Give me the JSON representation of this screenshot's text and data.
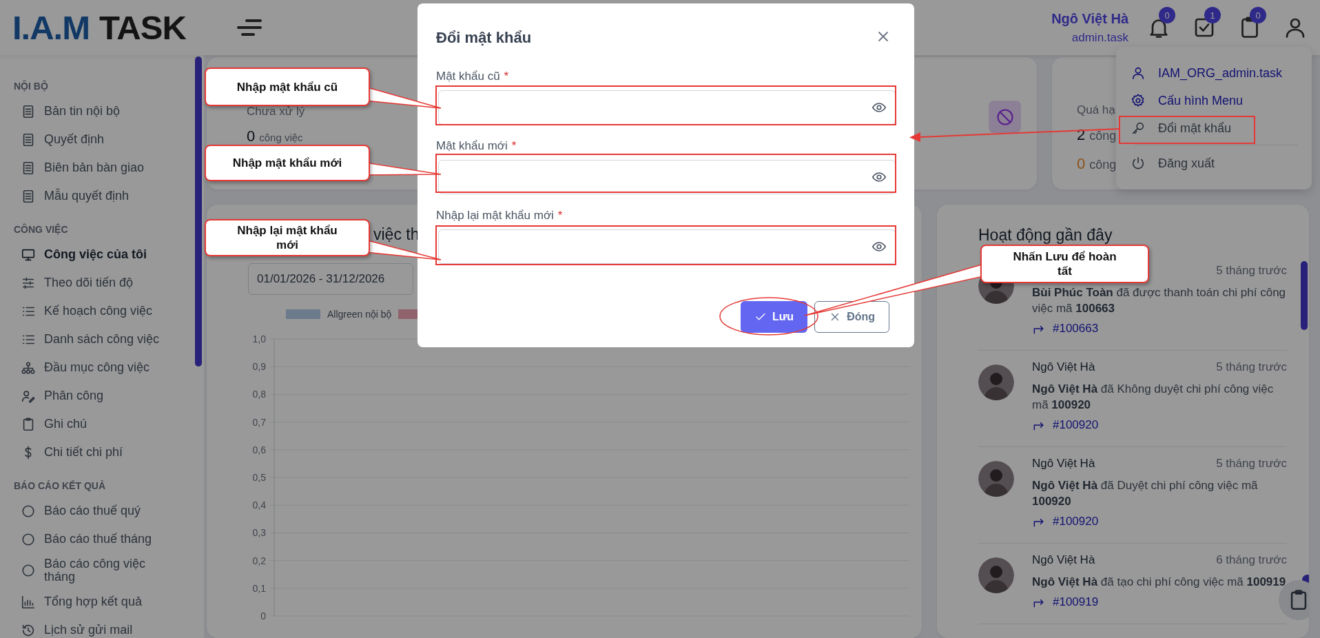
{
  "header": {
    "logo": {
      "primary": "I.A.M",
      "secondary": "TASK"
    },
    "user_name": "Ngô Việt Hà",
    "user_login": "admin.task",
    "badges": [
      "0",
      "1",
      "0"
    ]
  },
  "sidebar": {
    "sections": [
      {
        "title": "NỘI BỘ",
        "items": [
          {
            "label": "Bản tin nội bộ",
            "selected": false
          },
          {
            "label": "Quyết định",
            "selected": false
          },
          {
            "label": "Biên bản bàn giao",
            "selected": false
          },
          {
            "label": "Mẫu quyết định",
            "selected": false
          }
        ]
      },
      {
        "title": "CÔNG VIỆC",
        "items": [
          {
            "label": "Công việc của tôi",
            "selected": true
          },
          {
            "label": "Theo dõi tiến độ",
            "selected": false
          },
          {
            "label": "Kế hoạch công việc",
            "selected": false
          },
          {
            "label": "Danh sách công việc",
            "selected": false
          },
          {
            "label": "Đầu mục công việc",
            "selected": false
          },
          {
            "label": "Phân công",
            "selected": false
          },
          {
            "label": "Ghi chú",
            "selected": false
          },
          {
            "label": "Chi tiết chi phí",
            "selected": false
          }
        ]
      },
      {
        "title": "BÁO CÁO KẾT QUẢ",
        "items": [
          {
            "label": "Báo cáo thuế quý",
            "selected": false
          },
          {
            "label": "Báo cáo thuế tháng",
            "selected": false
          },
          {
            "label": "Báo cáo công việc tháng",
            "selected": false
          },
          {
            "label": "Tổng hợp kết quả",
            "selected": false
          },
          {
            "label": "Lịch sử gửi mail",
            "selected": false
          }
        ]
      }
    ]
  },
  "stats": [
    {
      "label": "Chưa xử lý",
      "value": "0",
      "unit": "công việc"
    },
    {
      "label": "Quá hạ",
      "value": "2",
      "unit": "công",
      "sub_value": "0",
      "sub_unit": "công"
    }
  ],
  "chart_card": {
    "title": "việc th",
    "date_range": "01/01/2026 - 31/12/2026",
    "chart_data": {
      "type": "bar",
      "grid": true,
      "ylim": [
        0,
        1
      ],
      "series": [
        {
          "name": "Allgreen nội bộ",
          "color": "#b4cdea"
        },
        {
          "color": "#f0a4b2"
        }
      ],
      "yticks": [
        {
          "value": 0,
          "label": "0"
        },
        {
          "value": 0.1,
          "label": "0,1"
        },
        {
          "value": 0.2,
          "label": "0,2"
        },
        {
          "value": 0.3,
          "label": "0,3"
        },
        {
          "value": 0.4,
          "label": "0,4"
        },
        {
          "value": 0.5,
          "label": "0,5"
        },
        {
          "value": 0.6,
          "label": "0,6"
        },
        {
          "value": 0.7,
          "label": "0,7"
        },
        {
          "value": 0.8,
          "label": "0,8"
        },
        {
          "value": 0.9,
          "label": "0,9"
        },
        {
          "value": 1,
          "label": "1,0"
        }
      ]
    }
  },
  "activity": {
    "title": "Hoạt động gần đây",
    "items": [
      {
        "time": "5 tháng trước",
        "text": "**Bùi Phúc Toàn** đã được thanh toán chi phí công việc mã **100663**",
        "link": "#100663"
      },
      {
        "name": "Ngô Việt Hà",
        "time": "5 tháng trước",
        "text": "**Ngô Việt Hà** đã Không duyệt chi phí công việc mã **100920**",
        "link": "#100920"
      },
      {
        "name": "Ngô Việt Hà",
        "time": "5 tháng trước",
        "text": "**Ngô Việt Hà** đã Duyệt chi phí công việc mã **100920**",
        "link": "#100920"
      },
      {
        "name": "Ngô Việt Hà",
        "time": "6 tháng trước",
        "text": "**Ngô Việt Hà** đã tạo chi phí công việc mã **100919**",
        "link": "#100919"
      }
    ]
  },
  "user_menu": {
    "items": [
      {
        "label": "IAM_ORG_admin.task",
        "kind": "link"
      },
      {
        "label": "Cấu hình Menu",
        "kind": "link"
      },
      {
        "label": "Đổi mật khẩu",
        "kind": "action"
      },
      {
        "label": "Đăng xuất",
        "kind": "action"
      }
    ]
  },
  "modal": {
    "title": "Đổi mật khẩu",
    "fields": [
      {
        "label": "Mật khẩu cũ",
        "required_mark": "*"
      },
      {
        "label": "Mật khẩu mới",
        "required_mark": "*"
      },
      {
        "label": "Nhập lại mật khẩu mới",
        "required_mark": "*"
      }
    ],
    "buttons": [
      {
        "label": "Lưu",
        "kind": "primary"
      },
      {
        "label": "Đóng",
        "kind": "secondary"
      }
    ]
  },
  "annotations": {
    "callouts": [
      "Nhập mật khẩu cũ",
      "Nhập mật khẩu mới",
      "Nhập lại mật khẩu mới",
      "Nhấn Lưu để hoàn tất"
    ]
  }
}
